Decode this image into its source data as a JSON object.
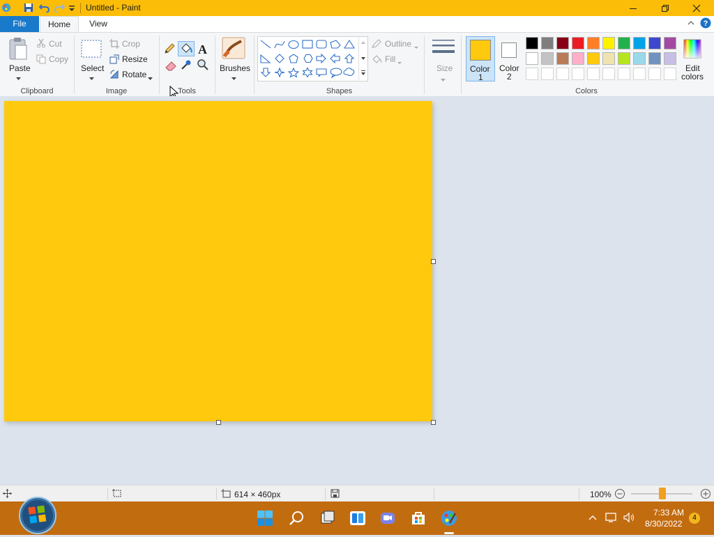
{
  "window": {
    "title": "Untitled - Paint"
  },
  "tabs": {
    "file": "File",
    "home": "Home",
    "view": "View"
  },
  "clipboard": {
    "paste": "Paste",
    "cut": "Cut",
    "copy": "Copy",
    "group": "Clipboard"
  },
  "image": {
    "select": "Select",
    "crop": "Crop",
    "resize": "Resize",
    "rotate": "Rotate",
    "group": "Image"
  },
  "tools": {
    "group": "Tools"
  },
  "brushes": {
    "label": "Brushes"
  },
  "shapes": {
    "outline": "Outline",
    "fill": "Fill",
    "group": "Shapes"
  },
  "size": {
    "label": "Size"
  },
  "colors": {
    "color1_line1": "Color",
    "color1_line2": "1",
    "color2_line1": "Color",
    "color2_line2": "2",
    "edit_line1": "Edit",
    "edit_line2": "colors",
    "group": "Colors",
    "color1_value": "#ffc90e",
    "color2_value": "#ffffff",
    "palette_row1": [
      "#000000",
      "#7f7f7f",
      "#880015",
      "#ed1c24",
      "#ff7f27",
      "#fff200",
      "#22b14c",
      "#00a2e8",
      "#3f48cc",
      "#a349a4"
    ],
    "palette_row2": [
      "#ffffff",
      "#c3c3c3",
      "#b97a57",
      "#ffaec9",
      "#ffc90e",
      "#efe4b0",
      "#b5e61d",
      "#99d9ea",
      "#7092be",
      "#c8bfe7"
    ],
    "palette_row3": [
      "#ffffff",
      "#ffffff",
      "#ffffff",
      "#ffffff",
      "#ffffff",
      "#ffffff",
      "#ffffff",
      "#ffffff",
      "#ffffff",
      "#ffffff"
    ]
  },
  "canvas": {
    "fill_color": "#ffc90e"
  },
  "status": {
    "dimensions": "614 × 460px",
    "zoom": "100%"
  },
  "taskbar": {
    "time": "7:33 AM",
    "date": "8/30/2022",
    "badge": "4"
  },
  "accent": {
    "titlebar": "#fbbd08",
    "file_tab": "#1979ca",
    "taskbar": "#c26c10"
  }
}
